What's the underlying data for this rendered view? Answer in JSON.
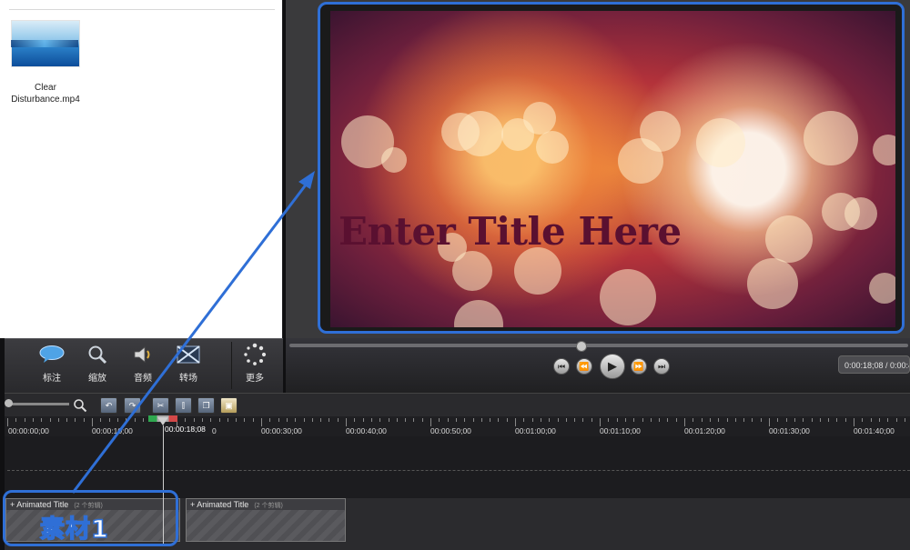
{
  "media_bin": {
    "clip_name": "Clear Disturbance.mp4"
  },
  "tools": [
    {
      "label": "标注",
      "icon": "callout-icon"
    },
    {
      "label": "缩放",
      "icon": "zoom-magnifier-icon"
    },
    {
      "label": "音频",
      "icon": "speaker-icon"
    },
    {
      "label": "转场",
      "icon": "transition-icon"
    },
    {
      "label": "更多",
      "icon": "more-spinner-icon"
    }
  ],
  "preview": {
    "title_text": "Enter Title Here"
  },
  "playback": {
    "time_display": "0:00:18;08 / 0:00:4",
    "progress_fraction": 0.47
  },
  "timeline": {
    "playhead_time": "00:00:18;08",
    "ruler_labels": [
      "00:00:00;00",
      "00:00:10;00",
      "0",
      "00:00:30;00",
      "00:00:40;00",
      "00:00:50;00",
      "00:01:00;00",
      "00:01:10;00",
      "00:01:20;00",
      "00:01:30;00",
      "00:01:40;00"
    ],
    "clips": [
      {
        "title": "Animated Title",
        "sub": "(2 个剪辑)"
      },
      {
        "title": "Animated Title",
        "sub": "(2 个剪辑)"
      }
    ]
  },
  "annotation": {
    "label": "素材1",
    "color": "#2f6fd6"
  }
}
